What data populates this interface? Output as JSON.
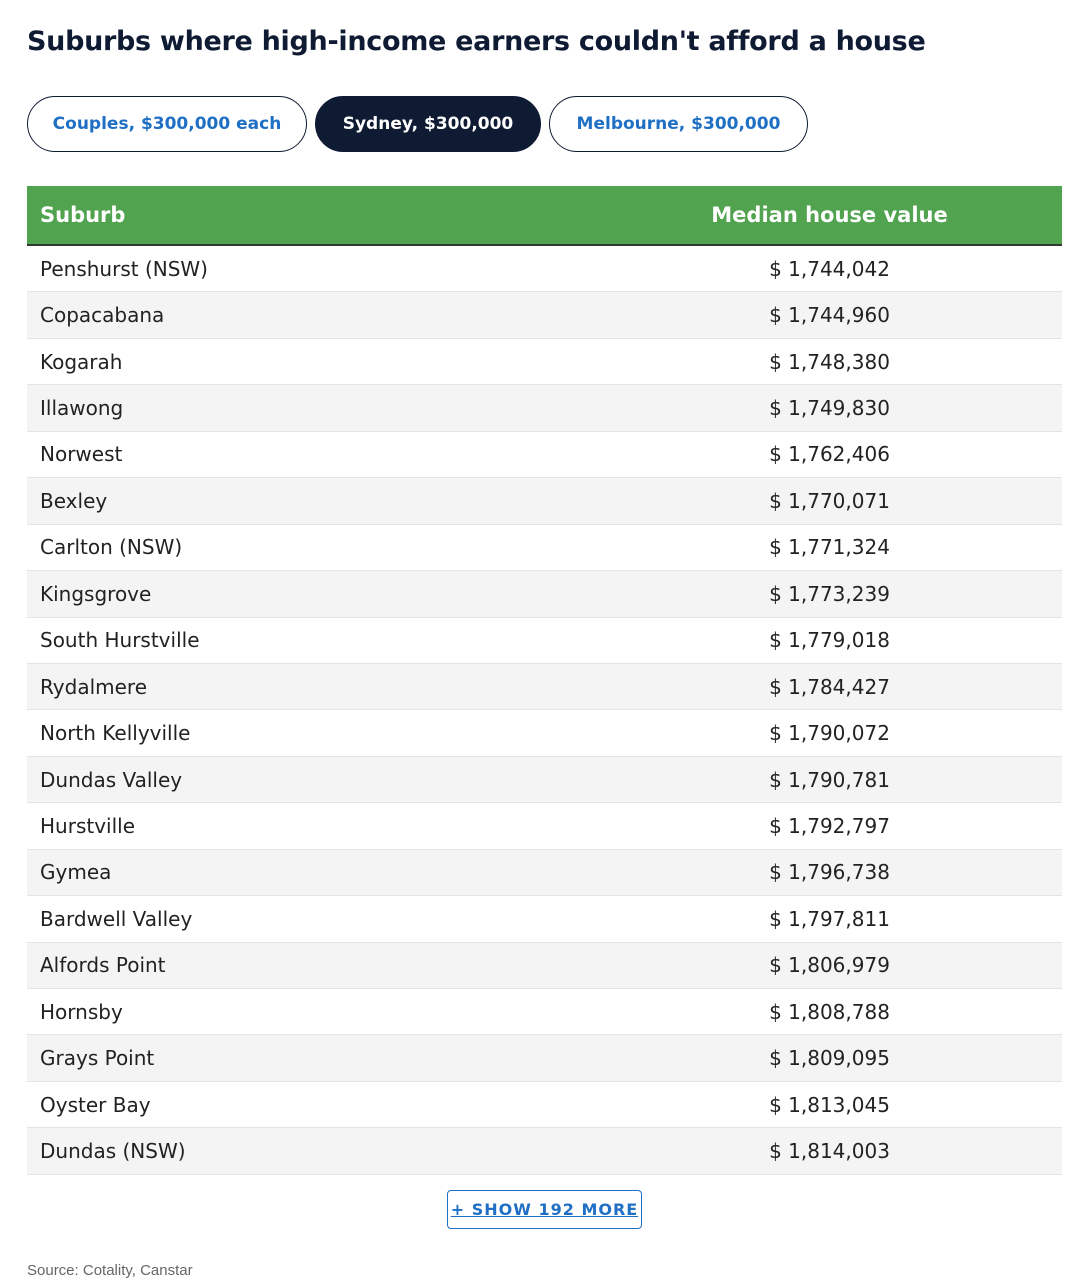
{
  "title": "Suburbs where high-income earners couldn't afford a house",
  "tabs": [
    {
      "label": "Couples, $300,000 each",
      "active": false
    },
    {
      "label": "Sydney, $300,000",
      "active": true
    },
    {
      "label": "Melbourne, $300,000",
      "active": false
    }
  ],
  "table": {
    "headers": [
      "Suburb",
      "Median house value"
    ],
    "rows": [
      [
        "Penshurst (NSW)",
        "$ 1,744,042"
      ],
      [
        "Copacabana",
        "$ 1,744,960"
      ],
      [
        "Kogarah",
        "$ 1,748,380"
      ],
      [
        "Illawong",
        "$ 1,749,830"
      ],
      [
        "Norwest",
        "$ 1,762,406"
      ],
      [
        "Bexley",
        "$ 1,770,071"
      ],
      [
        "Carlton (NSW)",
        "$ 1,771,324"
      ],
      [
        "Kingsgrove",
        "$ 1,773,239"
      ],
      [
        "South Hurstville",
        "$ 1,779,018"
      ],
      [
        "Rydalmere",
        "$ 1,784,427"
      ],
      [
        "North Kellyville",
        "$ 1,790,072"
      ],
      [
        "Dundas Valley",
        "$ 1,790,781"
      ],
      [
        "Hurstville",
        "$ 1,792,797"
      ],
      [
        "Gymea",
        "$ 1,796,738"
      ],
      [
        "Bardwell Valley",
        "$ 1,797,811"
      ],
      [
        "Alfords Point",
        "$ 1,806,979"
      ],
      [
        "Hornsby",
        "$ 1,808,788"
      ],
      [
        "Grays Point",
        "$ 1,809,095"
      ],
      [
        "Oyster Bay",
        "$ 1,813,045"
      ],
      [
        "Dundas (NSW)",
        "$ 1,814,003"
      ]
    ]
  },
  "show_more_label": "+ SHOW 192 MORE",
  "source": "Source: Cotality, Canstar",
  "colors": {
    "header_green": "#52a350",
    "navy": "#0f1b33",
    "link_blue": "#1f6fc5"
  }
}
